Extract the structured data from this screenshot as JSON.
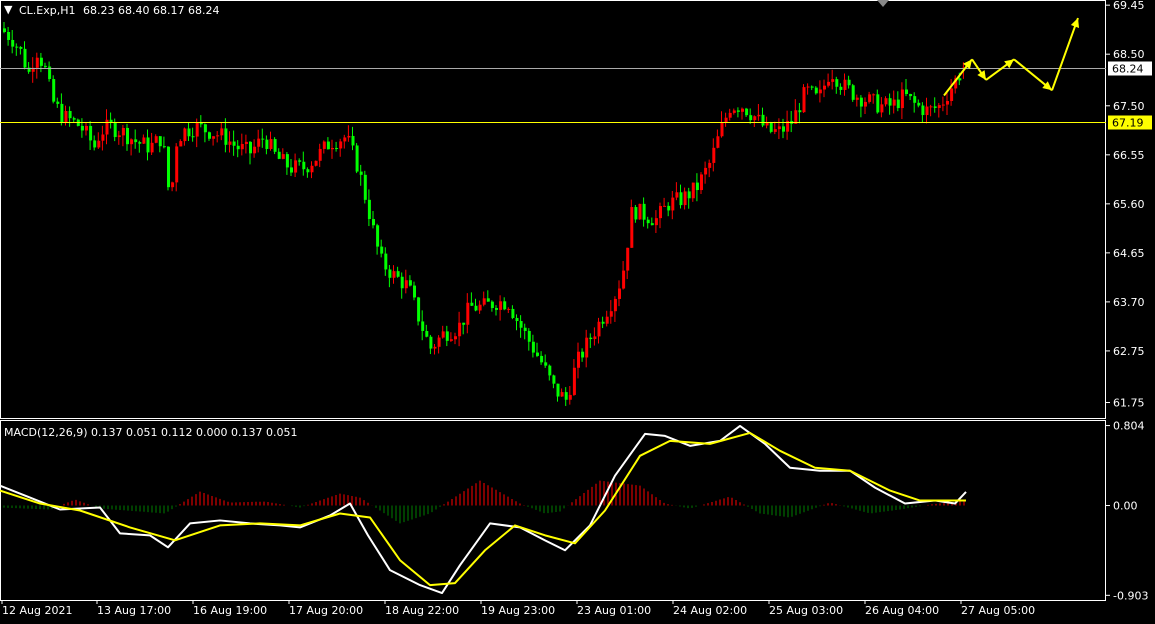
{
  "chart_data": [
    {
      "type": "candlestick",
      "symbol_label": "CL.Exp,H1",
      "ohlc_label": "68.23 68.40 68.17 68.24",
      "open": 68.23,
      "high": 68.4,
      "low": 68.17,
      "close": 68.24,
      "ylim": [
        61.45,
        69.55
      ],
      "y_ticks": [
        "69.45",
        "68.50",
        "67.50",
        "66.55",
        "65.60",
        "64.65",
        "63.70",
        "62.75",
        "61.75"
      ],
      "x_ticks": [
        "12 Aug 2021",
        "13 Aug 17:00",
        "16 Aug 19:00",
        "17 Aug 20:00",
        "18 Aug 22:00",
        "19 Aug 23:00",
        "23 Aug 01:00",
        "24 Aug 02:00",
        "25 Aug 03:00",
        "26 Aug 04:00",
        "27 Aug 05:00"
      ],
      "price_lines": [
        {
          "label": "68.24",
          "value": 68.24,
          "color": "#aaaaaa",
          "label_bg": "#ffffff",
          "label_fg": "#000000"
        },
        {
          "label": "67.19",
          "value": 67.19,
          "color": "#ffff00",
          "label_bg": "#ffff00",
          "label_fg": "#000000"
        }
      ],
      "close_path": [
        {
          "t": 0,
          "c": 69.0
        },
        {
          "t": 12,
          "c": 68.8
        },
        {
          "t": 22,
          "c": 68.5
        },
        {
          "t": 28,
          "c": 68.1
        },
        {
          "t": 36,
          "c": 68.6
        },
        {
          "t": 45,
          "c": 68.2
        },
        {
          "t": 52,
          "c": 67.6
        },
        {
          "t": 62,
          "c": 67.3
        },
        {
          "t": 72,
          "c": 67.2
        },
        {
          "t": 80,
          "c": 67.1
        },
        {
          "t": 88,
          "c": 66.9
        },
        {
          "t": 94,
          "c": 66.7
        },
        {
          "t": 100,
          "c": 67.0
        },
        {
          "t": 110,
          "c": 67.1
        },
        {
          "t": 122,
          "c": 67.0
        },
        {
          "t": 136,
          "c": 66.8
        },
        {
          "t": 150,
          "c": 66.7
        },
        {
          "t": 162,
          "c": 66.9
        },
        {
          "t": 170,
          "c": 65.6
        },
        {
          "t": 176,
          "c": 66.8
        },
        {
          "t": 182,
          "c": 67.0
        },
        {
          "t": 196,
          "c": 67.1
        },
        {
          "t": 210,
          "c": 67.0
        },
        {
          "t": 224,
          "c": 66.9
        },
        {
          "t": 236,
          "c": 66.7
        },
        {
          "t": 250,
          "c": 66.6
        },
        {
          "t": 264,
          "c": 66.9
        },
        {
          "t": 276,
          "c": 66.5
        },
        {
          "t": 290,
          "c": 66.3
        },
        {
          "t": 304,
          "c": 66.3
        },
        {
          "t": 316,
          "c": 66.5
        },
        {
          "t": 330,
          "c": 66.8
        },
        {
          "t": 346,
          "c": 66.9
        },
        {
          "t": 358,
          "c": 66.3
        },
        {
          "t": 368,
          "c": 65.5
        },
        {
          "t": 380,
          "c": 64.5
        },
        {
          "t": 394,
          "c": 64.2
        },
        {
          "t": 408,
          "c": 64.0
        },
        {
          "t": 420,
          "c": 63.3
        },
        {
          "t": 430,
          "c": 62.8
        },
        {
          "t": 444,
          "c": 63.1
        },
        {
          "t": 458,
          "c": 63.2
        },
        {
          "t": 470,
          "c": 63.6
        },
        {
          "t": 482,
          "c": 63.6
        },
        {
          "t": 496,
          "c": 63.7
        },
        {
          "t": 508,
          "c": 63.7
        },
        {
          "t": 518,
          "c": 63.3
        },
        {
          "t": 530,
          "c": 62.9
        },
        {
          "t": 542,
          "c": 62.5
        },
        {
          "t": 554,
          "c": 62.0
        },
        {
          "t": 566,
          "c": 61.8
        },
        {
          "t": 576,
          "c": 62.5
        },
        {
          "t": 590,
          "c": 63.0
        },
        {
          "t": 602,
          "c": 63.4
        },
        {
          "t": 614,
          "c": 63.8
        },
        {
          "t": 622,
          "c": 64.2
        },
        {
          "t": 632,
          "c": 65.5
        },
        {
          "t": 642,
          "c": 65.4
        },
        {
          "t": 656,
          "c": 65.3
        },
        {
          "t": 668,
          "c": 65.6
        },
        {
          "t": 682,
          "c": 65.7
        },
        {
          "t": 696,
          "c": 65.9
        },
        {
          "t": 710,
          "c": 66.4
        },
        {
          "t": 720,
          "c": 67.0
        },
        {
          "t": 730,
          "c": 67.5
        },
        {
          "t": 742,
          "c": 67.5
        },
        {
          "t": 754,
          "c": 67.3
        },
        {
          "t": 768,
          "c": 67.0
        },
        {
          "t": 780,
          "c": 67.0
        },
        {
          "t": 792,
          "c": 67.2
        },
        {
          "t": 806,
          "c": 67.8
        },
        {
          "t": 818,
          "c": 67.6
        },
        {
          "t": 830,
          "c": 68.2
        },
        {
          "t": 842,
          "c": 67.9
        },
        {
          "t": 856,
          "c": 67.7
        },
        {
          "t": 868,
          "c": 67.6
        },
        {
          "t": 880,
          "c": 67.5
        },
        {
          "t": 892,
          "c": 67.5
        },
        {
          "t": 904,
          "c": 67.7
        },
        {
          "t": 916,
          "c": 67.5
        },
        {
          "t": 928,
          "c": 67.4
        },
        {
          "t": 940,
          "c": 67.5
        },
        {
          "t": 952,
          "c": 67.9
        },
        {
          "t": 964,
          "c": 68.24
        }
      ],
      "forecast_arrows": [
        {
          "from": [
            944,
            67.7
          ],
          "to": [
            972,
            68.4
          ]
        },
        {
          "from": [
            972,
            68.4
          ],
          "to": [
            986,
            68.0
          ]
        },
        {
          "from": [
            986,
            68.0
          ],
          "to": [
            1014,
            68.4
          ]
        },
        {
          "from": [
            1014,
            68.4
          ],
          "to": [
            1052,
            67.8
          ]
        },
        {
          "from": [
            1052,
            67.8
          ],
          "to": [
            1078,
            69.2
          ]
        }
      ],
      "colors": {
        "background": "#000000",
        "bull": "#ff0000",
        "bear": "#00ff00",
        "grid_text": "#ffffff",
        "forecast": "#ffff00"
      }
    },
    {
      "type": "line",
      "indicator_label": "MACD(12,26,9) 0.137 0.051 0.112 0.000 0.137 0.051",
      "ylim": [
        -0.95,
        0.86
      ],
      "y_ticks": [
        "0.804",
        "0.00",
        "-0.903"
      ],
      "macd_points": [
        {
          "t": 0,
          "v": 0.2
        },
        {
          "t": 30,
          "v": 0.08
        },
        {
          "t": 60,
          "v": -0.04
        },
        {
          "t": 100,
          "v": -0.02
        },
        {
          "t": 120,
          "v": -0.28
        },
        {
          "t": 150,
          "v": -0.3
        },
        {
          "t": 168,
          "v": -0.42
        },
        {
          "t": 190,
          "v": -0.18
        },
        {
          "t": 220,
          "v": -0.15
        },
        {
          "t": 250,
          "v": -0.18
        },
        {
          "t": 280,
          "v": -0.2
        },
        {
          "t": 300,
          "v": -0.22
        },
        {
          "t": 330,
          "v": -0.1
        },
        {
          "t": 350,
          "v": 0.02
        },
        {
          "t": 368,
          "v": -0.3
        },
        {
          "t": 390,
          "v": -0.65
        },
        {
          "t": 420,
          "v": -0.8
        },
        {
          "t": 442,
          "v": -0.88
        },
        {
          "t": 460,
          "v": -0.6
        },
        {
          "t": 490,
          "v": -0.18
        },
        {
          "t": 520,
          "v": -0.22
        },
        {
          "t": 545,
          "v": -0.35
        },
        {
          "t": 565,
          "v": -0.45
        },
        {
          "t": 590,
          "v": -0.2
        },
        {
          "t": 615,
          "v": 0.3
        },
        {
          "t": 645,
          "v": 0.72
        },
        {
          "t": 665,
          "v": 0.7
        },
        {
          "t": 690,
          "v": 0.6
        },
        {
          "t": 720,
          "v": 0.65
        },
        {
          "t": 740,
          "v": 0.8
        },
        {
          "t": 765,
          "v": 0.62
        },
        {
          "t": 790,
          "v": 0.38
        },
        {
          "t": 820,
          "v": 0.35
        },
        {
          "t": 850,
          "v": 0.35
        },
        {
          "t": 875,
          "v": 0.18
        },
        {
          "t": 905,
          "v": 0.02
        },
        {
          "t": 935,
          "v": 0.05
        },
        {
          "t": 955,
          "v": 0.02
        },
        {
          "t": 966,
          "v": 0.137
        }
      ],
      "signal_points": [
        {
          "t": 0,
          "v": 0.15
        },
        {
          "t": 40,
          "v": 0.02
        },
        {
          "t": 80,
          "v": -0.05
        },
        {
          "t": 130,
          "v": -0.22
        },
        {
          "t": 175,
          "v": -0.35
        },
        {
          "t": 220,
          "v": -0.2
        },
        {
          "t": 260,
          "v": -0.18
        },
        {
          "t": 300,
          "v": -0.2
        },
        {
          "t": 340,
          "v": -0.08
        },
        {
          "t": 370,
          "v": -0.12
        },
        {
          "t": 400,
          "v": -0.55
        },
        {
          "t": 430,
          "v": -0.8
        },
        {
          "t": 455,
          "v": -0.78
        },
        {
          "t": 485,
          "v": -0.45
        },
        {
          "t": 515,
          "v": -0.2
        },
        {
          "t": 545,
          "v": -0.3
        },
        {
          "t": 575,
          "v": -0.38
        },
        {
          "t": 605,
          "v": -0.05
        },
        {
          "t": 640,
          "v": 0.5
        },
        {
          "t": 670,
          "v": 0.65
        },
        {
          "t": 710,
          "v": 0.62
        },
        {
          "t": 750,
          "v": 0.73
        },
        {
          "t": 780,
          "v": 0.55
        },
        {
          "t": 815,
          "v": 0.38
        },
        {
          "t": 850,
          "v": 0.35
        },
        {
          "t": 890,
          "v": 0.15
        },
        {
          "t": 920,
          "v": 0.05
        },
        {
          "t": 966,
          "v": 0.051
        }
      ],
      "histogram_points": [
        {
          "t": 0,
          "v": -0.02
        },
        {
          "t": 50,
          "v": -0.04
        },
        {
          "t": 75,
          "v": 0.06
        },
        {
          "t": 100,
          "v": -0.03
        },
        {
          "t": 140,
          "v": -0.06
        },
        {
          "t": 165,
          "v": -0.08
        },
        {
          "t": 200,
          "v": 0.14
        },
        {
          "t": 230,
          "v": 0.03
        },
        {
          "t": 265,
          "v": 0.04
        },
        {
          "t": 300,
          "v": -0.02
        },
        {
          "t": 340,
          "v": 0.12
        },
        {
          "t": 360,
          "v": 0.08
        },
        {
          "t": 400,
          "v": -0.18
        },
        {
          "t": 430,
          "v": -0.08
        },
        {
          "t": 480,
          "v": 0.25
        },
        {
          "t": 520,
          "v": 0.02
        },
        {
          "t": 545,
          "v": -0.08
        },
        {
          "t": 560,
          "v": -0.06
        },
        {
          "t": 600,
          "v": 0.25
        },
        {
          "t": 640,
          "v": 0.2
        },
        {
          "t": 665,
          "v": 0.02
        },
        {
          "t": 690,
          "v": -0.03
        },
        {
          "t": 730,
          "v": 0.09
        },
        {
          "t": 760,
          "v": -0.08
        },
        {
          "t": 790,
          "v": -0.12
        },
        {
          "t": 830,
          "v": 0.03
        },
        {
          "t": 870,
          "v": -0.08
        },
        {
          "t": 900,
          "v": -0.04
        },
        {
          "t": 930,
          "v": 0.01
        },
        {
          "t": 966,
          "v": 0.05
        }
      ],
      "colors": {
        "macd": "#ffffff",
        "signal": "#ffff00",
        "hist_pos": "#ff0000",
        "hist_neg": "#008000"
      }
    }
  ]
}
